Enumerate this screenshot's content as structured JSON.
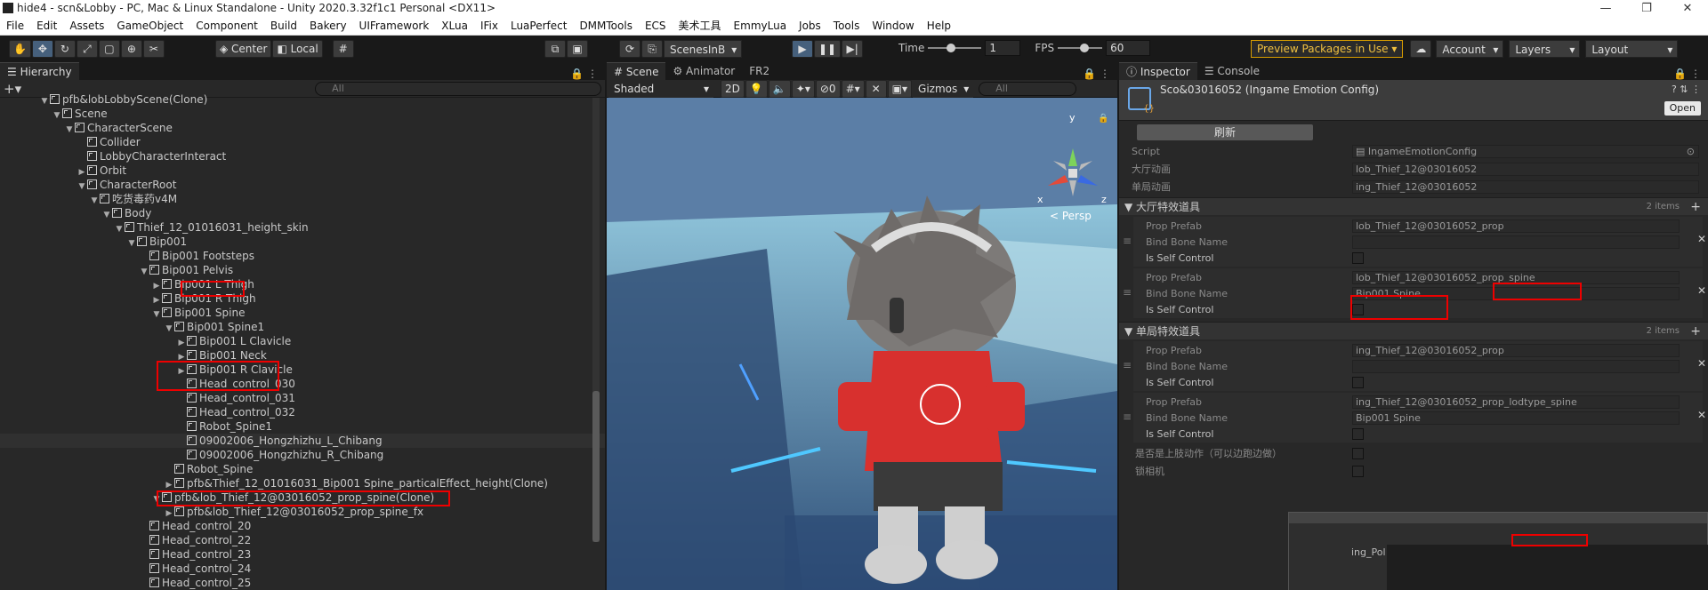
{
  "window": {
    "title": "hide4 - scn&Lobby - PC, Mac & Linux Standalone - Unity 2020.3.32f1c1 Personal <DX11>"
  },
  "menu": [
    "File",
    "Edit",
    "Assets",
    "GameObject",
    "Component",
    "Build",
    "Bakery",
    "UIFramework",
    "XLua",
    "IFix",
    "LuaPerfect",
    "DMMTools",
    "ECS",
    "美术工具",
    "EmmyLua",
    "Jobs",
    "Tools",
    "Window",
    "Help"
  ],
  "toolbar": {
    "center": "Center",
    "local": "Local",
    "scenes": "ScenesInB",
    "time_label": "Time",
    "time_value": "1",
    "fps_label": "FPS",
    "fps_value": "60",
    "preview": "Preview Packages in Use",
    "account": "Account",
    "layers": "Layers",
    "layout": "Layout",
    "time_level": 0.35,
    "fps_level": 0.5
  },
  "hierarchy": {
    "tab": "Hierarchy",
    "search_placeholder": "All",
    "rows": [
      {
        "depth": 1,
        "arrow": "▼",
        "label": "pfb&lobLobbyScene(Clone)"
      },
      {
        "depth": 2,
        "arrow": "▼",
        "label": "Scene"
      },
      {
        "depth": 3,
        "arrow": "▼",
        "label": "CharacterScene"
      },
      {
        "depth": 4,
        "arrow": "",
        "label": "Collider"
      },
      {
        "depth": 4,
        "arrow": "",
        "label": "LobbyCharacterInteract"
      },
      {
        "depth": 4,
        "arrow": "▶",
        "label": "Orbit"
      },
      {
        "depth": 4,
        "arrow": "▼",
        "label": "CharacterRoot"
      },
      {
        "depth": 5,
        "arrow": "▼",
        "label": "吃货毒药v4M"
      },
      {
        "depth": 6,
        "arrow": "▼",
        "label": "Body"
      },
      {
        "depth": 7,
        "arrow": "▼",
        "label": "Thief_12_01016031_height_skin"
      },
      {
        "depth": 8,
        "arrow": "▼",
        "label": "Bip001"
      },
      {
        "depth": 9,
        "arrow": "",
        "label": "Bip001 Footsteps"
      },
      {
        "depth": 9,
        "arrow": "▼",
        "label": "Bip001 Pelvis"
      },
      {
        "depth": 10,
        "arrow": "▶",
        "label": "Bip001 L Thigh"
      },
      {
        "depth": 10,
        "arrow": "▶",
        "label": "Bip001 R Thigh"
      },
      {
        "depth": 10,
        "arrow": "▼",
        "label": "Bip001 Spine"
      },
      {
        "depth": 11,
        "arrow": "▼",
        "label": "Bip001 Spine1"
      },
      {
        "depth": 12,
        "arrow": "▶",
        "label": "Bip001 L Clavicle"
      },
      {
        "depth": 12,
        "arrow": "▶",
        "label": "Bip001 Neck"
      },
      {
        "depth": 12,
        "arrow": "▶",
        "label": "Bip001 R Clavicle"
      },
      {
        "depth": 12,
        "arrow": "",
        "label": "Head_control_030"
      },
      {
        "depth": 12,
        "arrow": "",
        "label": "Head_control_031"
      },
      {
        "depth": 12,
        "arrow": "",
        "label": "Head_control_032"
      },
      {
        "depth": 12,
        "arrow": "",
        "label": "Robot_Spine1"
      },
      {
        "depth": 12,
        "arrow": "",
        "label": "09002006_Hongzhizhu_L_Chibang"
      },
      {
        "depth": 12,
        "arrow": "",
        "label": "09002006_Hongzhizhu_R_Chibang"
      },
      {
        "depth": 11,
        "arrow": "",
        "label": "Robot_Spine"
      },
      {
        "depth": 11,
        "arrow": "▶",
        "label": "pfb&Thief_12_01016031_Bip001 Spine_particalEffect_height(Clone)"
      },
      {
        "depth": 10,
        "arrow": "▼",
        "label": "pfb&lob_Thief_12@03016052_prop_spine(Clone)"
      },
      {
        "depth": 11,
        "arrow": "▶",
        "label": "pfb&lob_Thief_12@03016052_prop_spine_fx"
      },
      {
        "depth": 9,
        "arrow": "",
        "label": "Head_control_20"
      },
      {
        "depth": 9,
        "arrow": "",
        "label": "Head_control_22"
      },
      {
        "depth": 9,
        "arrow": "",
        "label": "Head_control_23"
      },
      {
        "depth": 9,
        "arrow": "",
        "label": "Head_control_24"
      },
      {
        "depth": 9,
        "arrow": "",
        "label": "Head_control_25"
      }
    ]
  },
  "scene": {
    "tabs": [
      "Scene",
      "Animator",
      "FR2"
    ],
    "shaded": "Shaded",
    "mode2d": "2D",
    "gizmos": "Gizmos",
    "search_placeholder": "All",
    "persp": "< Persp",
    "hidden_count": "0",
    "axis_x": "x",
    "axis_y": "y",
    "axis_z": "z"
  },
  "inspector": {
    "tabs": [
      "Inspector",
      "Console"
    ],
    "title": "Sco&03016052 (Ingame Emotion Config)",
    "open": "Open",
    "refresh": "刷新",
    "script_label": "Script",
    "script_value": "IngameEmotionConfig",
    "lobby_anim_label": "大厅动画",
    "lobby_anim_value": "lob_Thief_12@03016052",
    "game_anim_label": "单局动画",
    "game_anim_value": "ing_Thief_12@03016052",
    "lobby_props": {
      "title": "大厅特效道具",
      "count": "2 items",
      "items": [
        {
          "prefab_label": "Prop Prefab",
          "prefab": "lob_Thief_12@03016052_prop",
          "bone_label": "Bind Bone Name",
          "bone": "",
          "self_label": "Is Self Control"
        },
        {
          "prefab_label": "Prop Prefab",
          "prefab": "lob_Thief_12@03016052_prop_spine",
          "bone_label": "Bind Bone Name",
          "bone": "Bip001 Spine",
          "self_label": "Is Self Control"
        }
      ]
    },
    "game_props": {
      "title": "单局特效道具",
      "count": "2 items",
      "items": [
        {
          "prefab_label": "Prop Prefab",
          "prefab": "ing_Thief_12@03016052_prop",
          "bone_label": "Bind Bone Name",
          "bone": "",
          "self_label": "Is Self Control"
        },
        {
          "prefab_label": "Prop Prefab",
          "prefab": "ing_Thief_12@03016052_prop_lodtype_spine",
          "bone_label": "Bind Bone Name",
          "bone": "Bip001 Spine",
          "self_label": "Is Self Control"
        }
      ]
    },
    "is_upper_label": "是否是上肢动作（可以边跑边做）",
    "lock_cam_label": "锁相机",
    "bottom_preview": "ing_Pol"
  }
}
